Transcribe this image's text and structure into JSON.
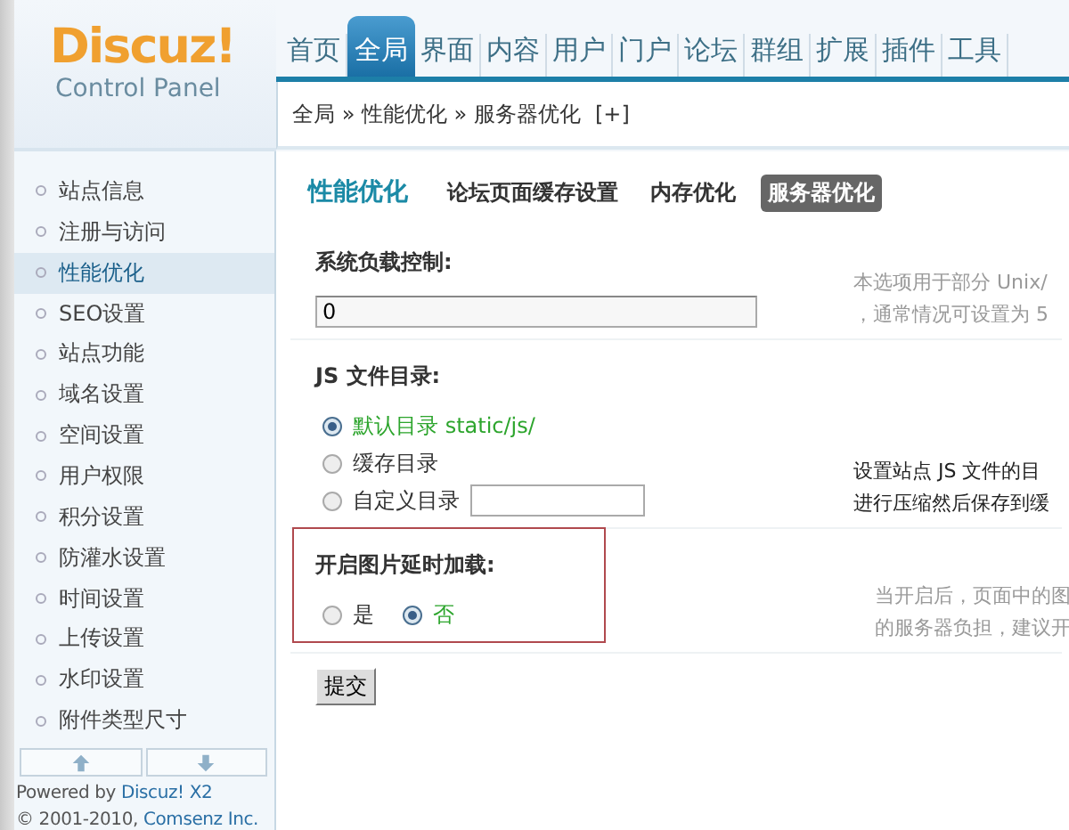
{
  "logo": {
    "title": "Discuz!",
    "subtitle": "Control Panel"
  },
  "nav": [
    {
      "label": "首页",
      "selected": false
    },
    {
      "label": "全局",
      "selected": true
    },
    {
      "label": "界面",
      "selected": false
    },
    {
      "label": "内容",
      "selected": false
    },
    {
      "label": "用户",
      "selected": false
    },
    {
      "label": "门户",
      "selected": false
    },
    {
      "label": "论坛",
      "selected": false
    },
    {
      "label": "群组",
      "selected": false
    },
    {
      "label": "扩展",
      "selected": false
    },
    {
      "label": "插件",
      "selected": false
    },
    {
      "label": "工具",
      "selected": false
    }
  ],
  "breadcrumb": {
    "path": "全局 » 性能优化 » 服务器优化",
    "add": "[+]"
  },
  "sidebar": {
    "items": [
      {
        "label": "站点信息",
        "selected": false
      },
      {
        "label": "注册与访问",
        "selected": false
      },
      {
        "label": "性能优化",
        "selected": true
      },
      {
        "label": "SEO设置",
        "selected": false
      },
      {
        "label": "站点功能",
        "selected": false
      },
      {
        "label": "域名设置",
        "selected": false
      },
      {
        "label": "空间设置",
        "selected": false
      },
      {
        "label": "用户权限",
        "selected": false
      },
      {
        "label": "积分设置",
        "selected": false
      },
      {
        "label": "防灌水设置",
        "selected": false
      },
      {
        "label": "时间设置",
        "selected": false
      },
      {
        "label": "上传设置",
        "selected": false
      },
      {
        "label": "水印设置",
        "selected": false
      },
      {
        "label": "附件类型尺寸",
        "selected": false
      }
    ],
    "powered_by": {
      "text": "Powered by",
      "link": "Discuz! X2"
    },
    "copyright": {
      "text": "© 2001-2010,",
      "link": "Comsenz Inc."
    }
  },
  "page": {
    "title": "性能优化",
    "tabs": [
      {
        "label": "论坛页面缓存设置",
        "selected": false
      },
      {
        "label": "内存优化",
        "selected": false
      },
      {
        "label": "服务器优化",
        "selected": true
      }
    ]
  },
  "sections": [
    {
      "kind": "text",
      "label": "系统负载控制:",
      "value": "0",
      "help": [
        "本选项用于部分 Unix/",
        "，通常情况可设置为 5"
      ],
      "help_emphasized": false,
      "highlighted": false
    },
    {
      "kind": "radio_stacked",
      "label": "JS 文件目录:",
      "options": [
        {
          "label": "默认目录 static/js/",
          "selected": true,
          "kind": "plain"
        },
        {
          "label": "缓存目录",
          "selected": false,
          "kind": "plain"
        },
        {
          "label": "自定义目录",
          "selected": false,
          "kind": "with_input"
        }
      ],
      "help": [
        "设置站点 JS 文件的目",
        "进行压缩然后保存到缓"
      ],
      "help_emphasized": true,
      "highlighted": false
    },
    {
      "kind": "radio_inline",
      "label": "开启图片延时加载:",
      "options": [
        {
          "label": "是",
          "selected": false,
          "kind": "plain"
        },
        {
          "label": "否",
          "selected": true,
          "kind": "plain"
        }
      ],
      "help": [
        "当开启后，页面中的图",
        "的服务器负担，建议开"
      ],
      "help_emphasized": false,
      "highlighted": true
    }
  ],
  "submit": "提交"
}
